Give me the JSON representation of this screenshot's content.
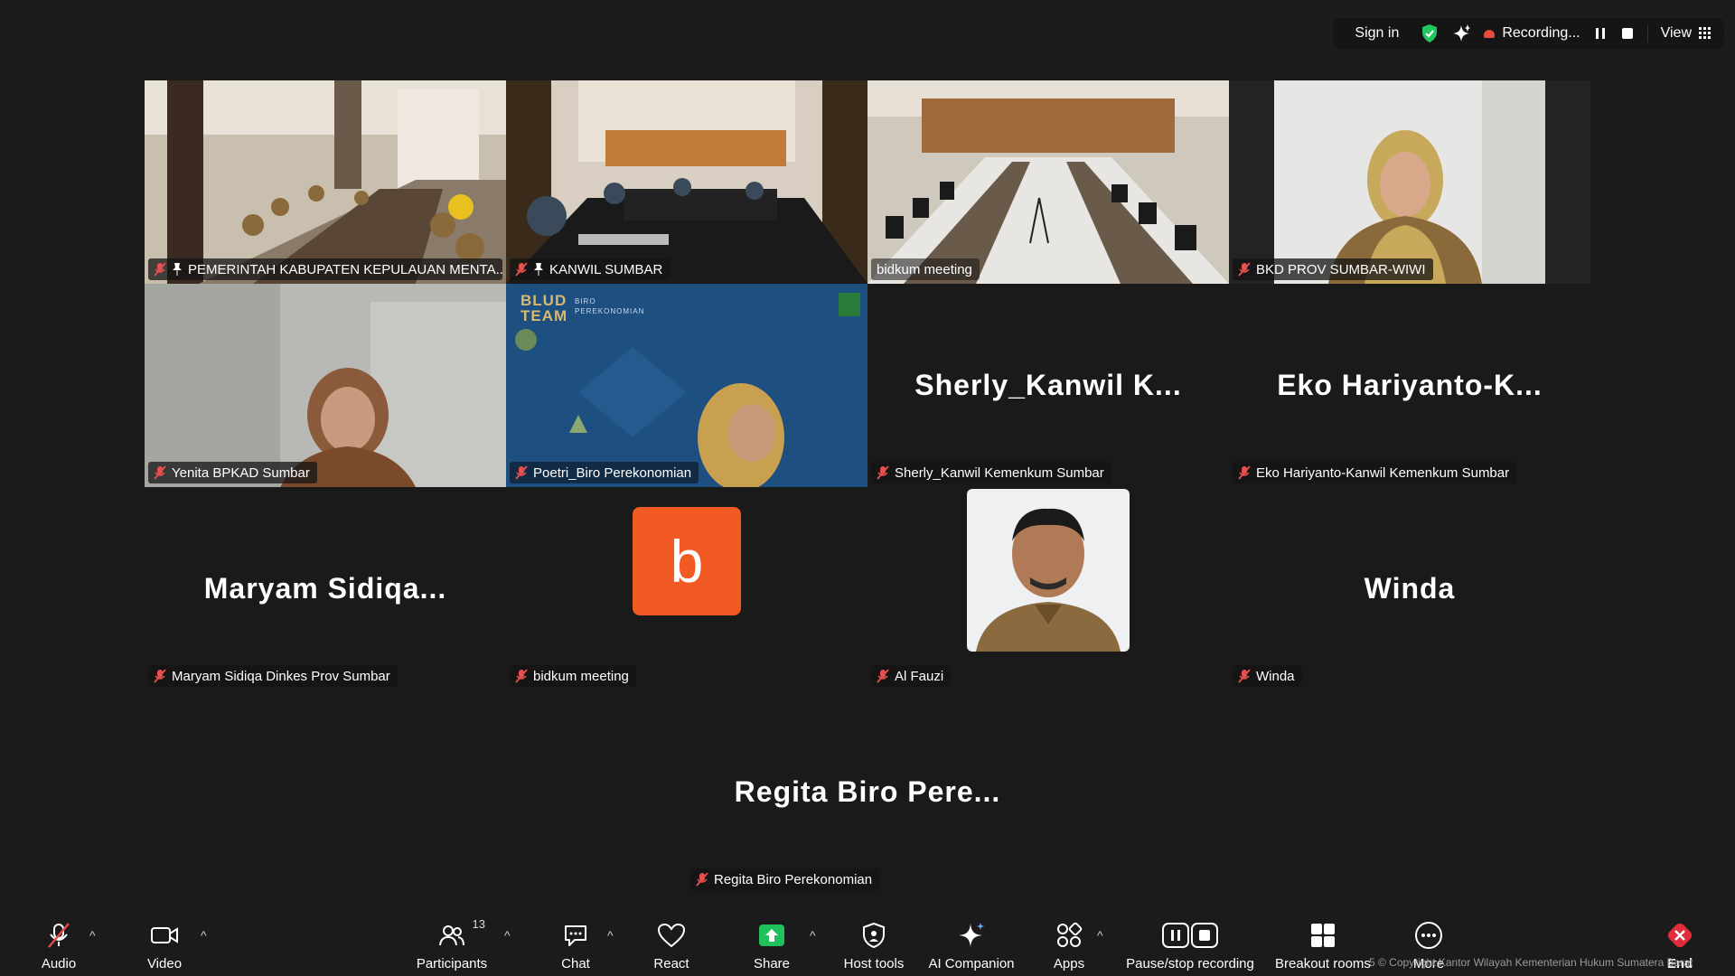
{
  "topbar": {
    "sign_in": "Sign in",
    "recording": "Recording...",
    "view": "View"
  },
  "tiles": [
    {
      "name": "PEMERINTAH KABUPATEN KEPULAUAN MENTA...",
      "pinned": true
    },
    {
      "name": "KANWIL SUMBAR",
      "pinned": true
    },
    {
      "name": "bidkum meeting",
      "pinned": false,
      "active": true
    },
    {
      "name": "BKD PROV SUMBAR-WIWI",
      "pinned": false
    },
    {
      "name": "Yenita BPKAD Sumbar"
    },
    {
      "name": "Poetri_Biro Perekonomian",
      "bg_text_1": "BLUD TEAM",
      "bg_text_2": "BIRO PEREKONOMIAN"
    },
    {
      "name": "Sherly_Kanwil Kemenkum Sumbar",
      "display": "Sherly_Kanwil  K..."
    },
    {
      "name": "Eko Hariyanto-Kanwil Kemenkum Sumbar",
      "display": "Eko  Hariyanto-K..."
    },
    {
      "name": "Maryam Sidiqa Dinkes Prov Sumbar",
      "display": "Maryam  Sidiqa..."
    },
    {
      "name": "bidkum meeting",
      "avatar_letter": "b"
    },
    {
      "name": "Al Fauzi"
    },
    {
      "name": "Winda",
      "display": "Winda"
    },
    {
      "name": "Regita Biro Perekonomian",
      "display": "Regita  Biro  Pere..."
    }
  ],
  "toolbar": {
    "audio": "Audio",
    "video": "Video",
    "participants": "Participants",
    "participants_count": "13",
    "chat": "Chat",
    "react": "React",
    "share": "Share",
    "host_tools": "Host tools",
    "ai_companion": "AI Companion",
    "apps": "Apps",
    "pause_stop": "Pause/stop recording",
    "breakout": "Breakout rooms",
    "more": "More",
    "end": "End"
  },
  "footer_note": "5 © Copyright Kantor Wilayah Kementerian Hukum Sumatera Barat",
  "colors": {
    "active_border": "#2fd67a",
    "record": "#e74c3c",
    "share": "#20c05c",
    "end": "#e02d3c",
    "avatar": "#f15a22"
  }
}
